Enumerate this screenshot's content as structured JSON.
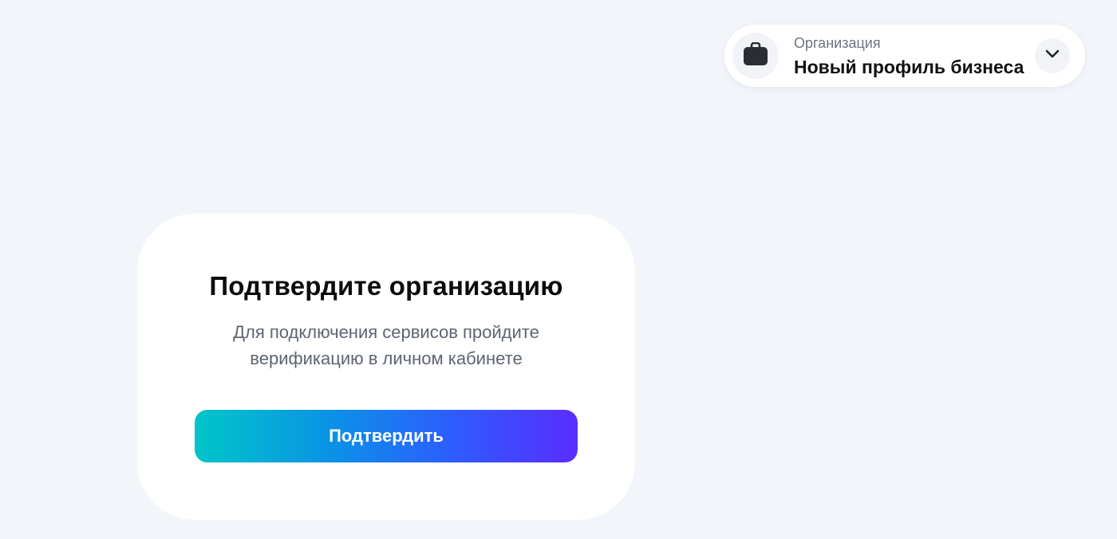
{
  "organization": {
    "label": "Организация",
    "name": "Новый профиль бизнеса",
    "icon": "briefcase-icon",
    "dropdown_icon": "chevron-down-icon"
  },
  "verification": {
    "title": "Подтвердите организацию",
    "description": "Для подключения сервисов пройдите верификацию в личном кабинете",
    "button_label": "Подтвердить"
  },
  "colors": {
    "background": "#f2f5f9",
    "card": "#ffffff",
    "button_gradient_start": "#00c6c8",
    "button_gradient_end": "#5a2dff",
    "icon_dark": "#2a2d33"
  }
}
